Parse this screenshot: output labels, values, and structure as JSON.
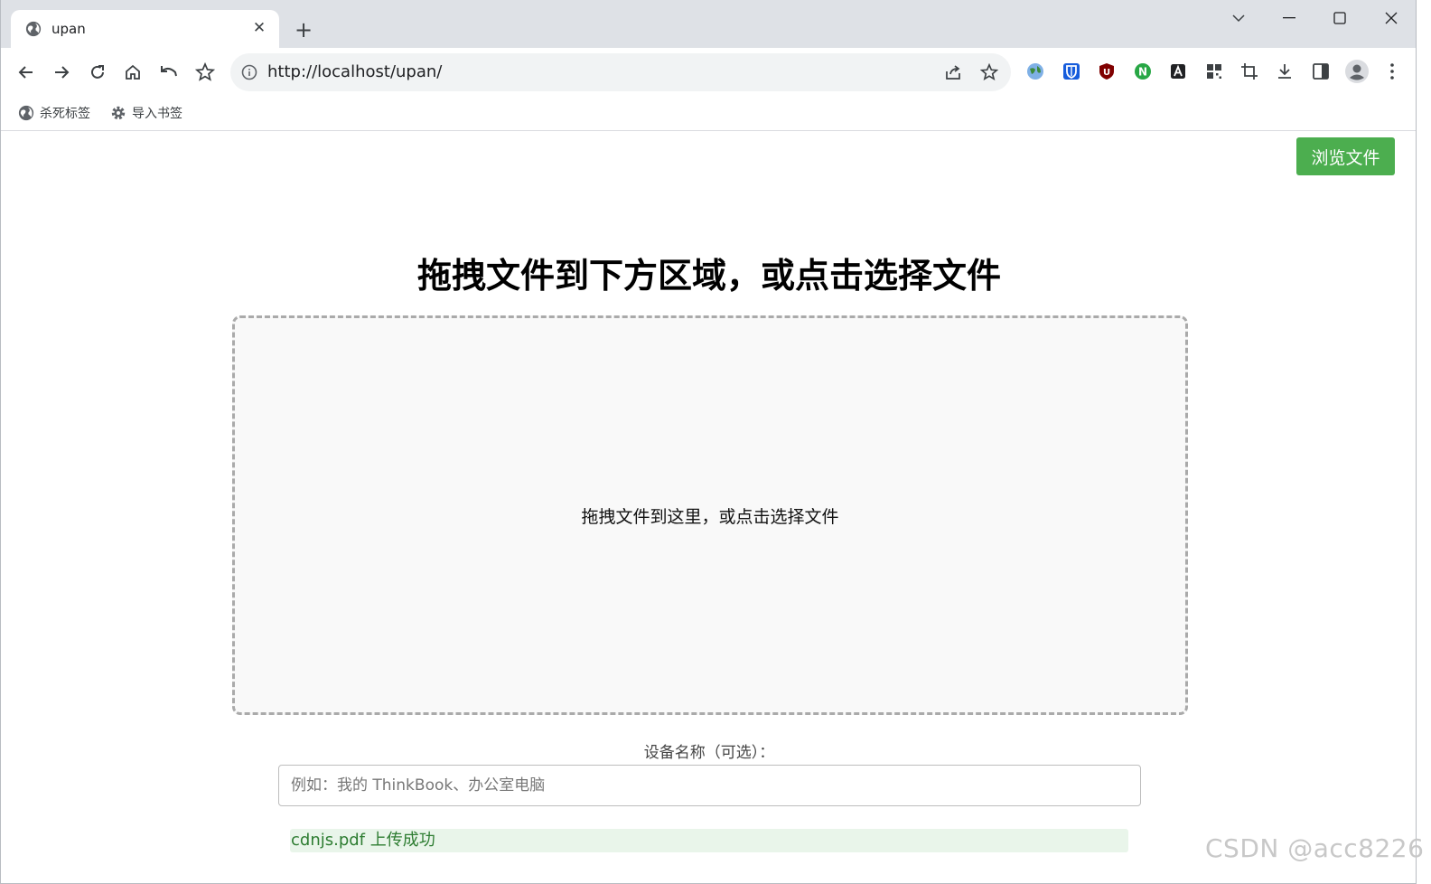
{
  "tab": {
    "title": "upan",
    "favicon": "globe-icon"
  },
  "toolbar": {
    "url": "http://localhost/upan/"
  },
  "bookmarks": [
    {
      "label": "杀死标签",
      "icon": "globe-icon"
    },
    {
      "label": "导入书签",
      "icon": "gear-icon"
    }
  ],
  "extensions": [
    {
      "name": "globe-extension-icon",
      "color": "#3a78c9"
    },
    {
      "name": "bitwarden-icon",
      "color": "#175ddc"
    },
    {
      "name": "ublock-icon",
      "color": "#800000"
    },
    {
      "name": "n-extension-icon",
      "color": "#28a745"
    },
    {
      "name": "a-extension-icon",
      "color": "#202124"
    }
  ],
  "page": {
    "browse_button": "浏览文件",
    "title": "拖拽文件到下方区域，或点击选择文件",
    "dropzone_text": "拖拽文件到这里，或点击选择文件",
    "device_label": "设备名称（可选）：",
    "device_placeholder": "例如：我的 ThinkBook、办公室电脑",
    "status_message": "cdnjs.pdf 上传成功"
  },
  "watermark": "CSDN @acc8226",
  "colors": {
    "accent_green": "#4cae4f",
    "success_text": "#2e7d32",
    "success_bg": "#e9f5ea"
  }
}
